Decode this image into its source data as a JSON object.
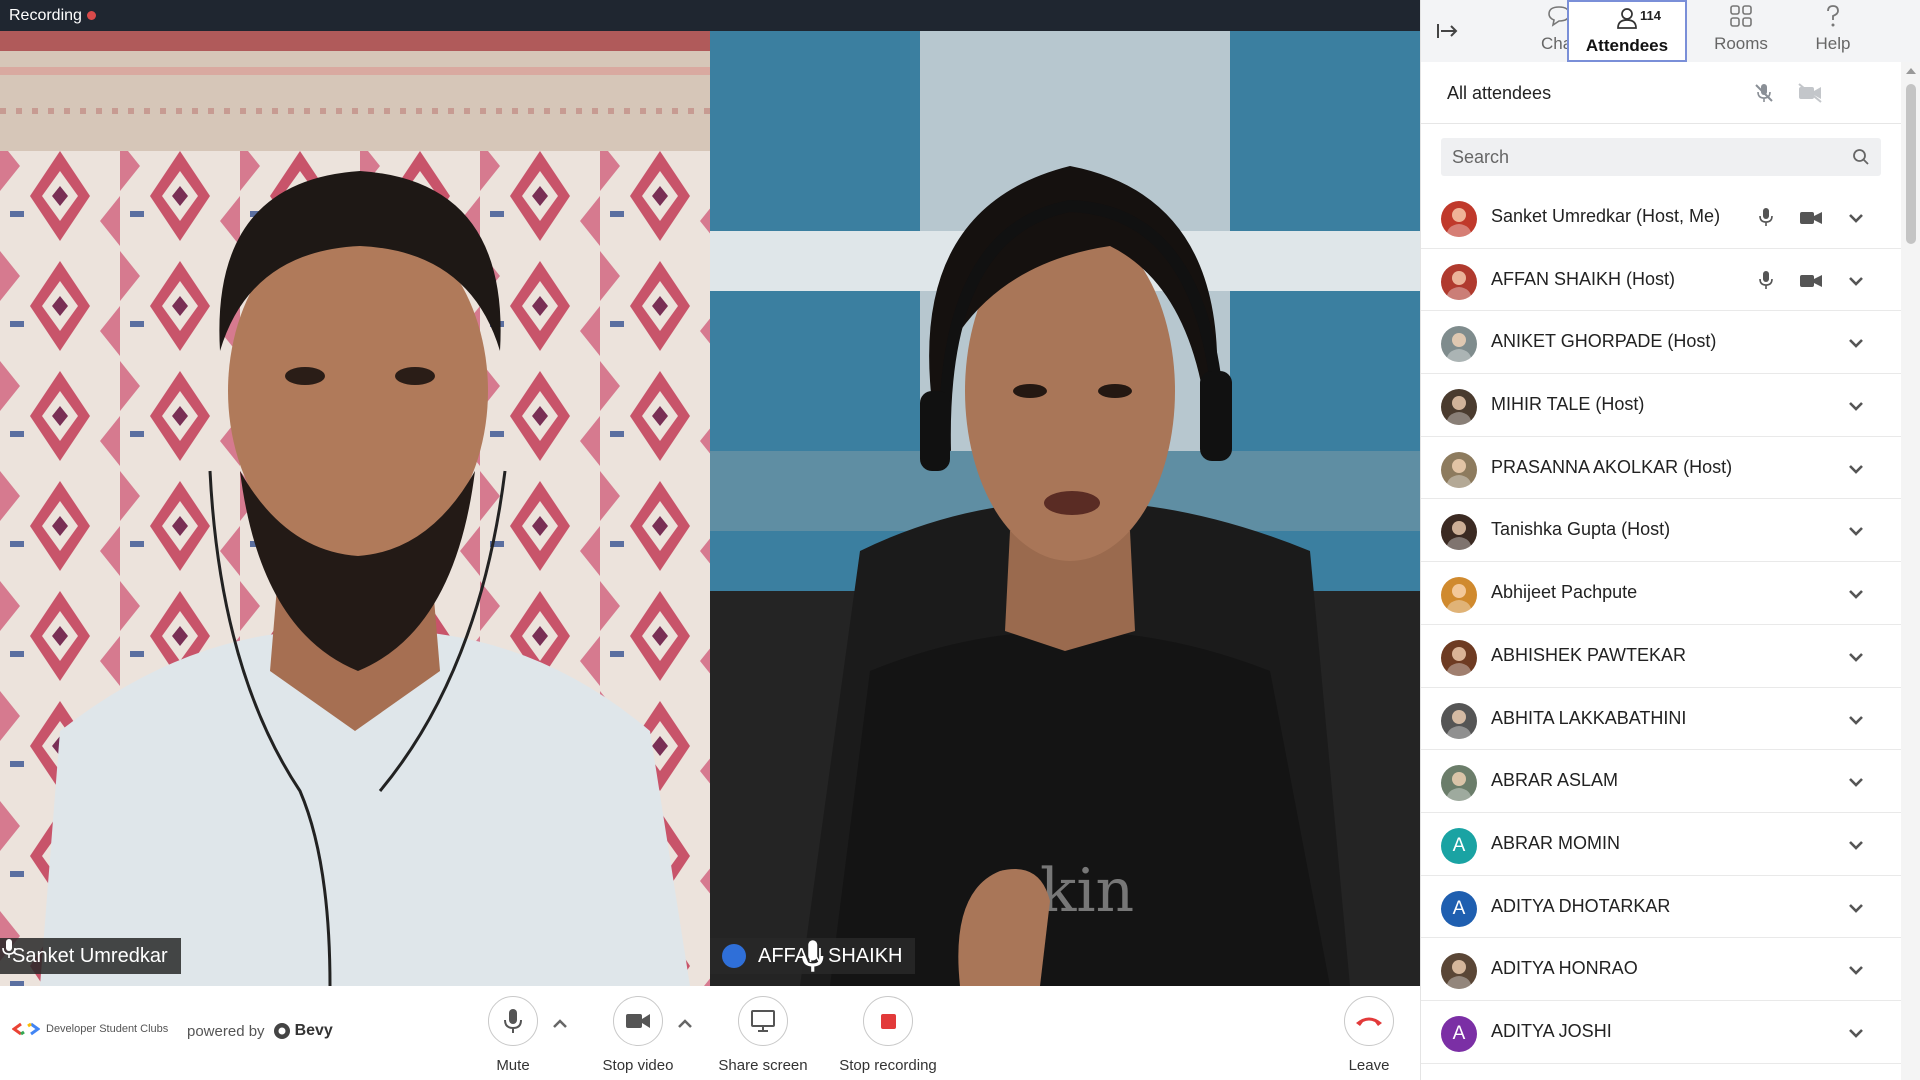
{
  "topbar": {
    "recording_label": "Recording"
  },
  "tiles": [
    {
      "name": "Sanket Umredkar",
      "mic_state": "active"
    },
    {
      "name": "AFFAN SHAIKH",
      "mic_state": "speaking"
    }
  ],
  "bottombar": {
    "brand": "Developer Student Clubs",
    "powered_by": "powered by",
    "bevy": "Bevy",
    "controls": {
      "mute": "Mute",
      "stop_video": "Stop video",
      "share_screen": "Share screen",
      "stop_recording": "Stop recording",
      "leave": "Leave"
    }
  },
  "panel": {
    "tabs": {
      "chat": "Chat",
      "attendees": "Attendees",
      "attendees_count": "114",
      "rooms": "Rooms",
      "help": "Help"
    },
    "all_attendees": "All attendees",
    "search_placeholder": "Search",
    "attendees": [
      {
        "name": "Sanket Umredkar (Host, Me)",
        "avatar": "photo",
        "color": "#c0392b",
        "media": true
      },
      {
        "name": "AFFAN SHAIKH (Host)",
        "avatar": "photo",
        "color": "#b03a2e",
        "media": true
      },
      {
        "name": "ANIKET GHORPADE (Host)",
        "avatar": "photo",
        "color": "#7f8c8d",
        "media": false
      },
      {
        "name": "MIHIR TALE (Host)",
        "avatar": "photo",
        "color": "#4a3b2e",
        "media": false
      },
      {
        "name": "PRASANNA AKOLKAR (Host)",
        "avatar": "photo",
        "color": "#8d7b5e",
        "media": false
      },
      {
        "name": "Tanishka Gupta (Host)",
        "avatar": "photo",
        "color": "#3b2a22",
        "media": false
      },
      {
        "name": "Abhijeet Pachpute",
        "avatar": "photo",
        "color": "#d08a2e",
        "media": false
      },
      {
        "name": "ABHISHEK PAWTEKAR",
        "avatar": "photo",
        "color": "#6e3b22",
        "media": false
      },
      {
        "name": "ABHITA LAKKABATHINI",
        "avatar": "photo",
        "color": "#555555",
        "media": false
      },
      {
        "name": "ABRAR ASLAM",
        "avatar": "photo",
        "color": "#6b7d6a",
        "media": false
      },
      {
        "name": "ABRAR MOMIN",
        "avatar": "A",
        "color": "#1aa3a3",
        "media": false
      },
      {
        "name": "ADITYA DHOTARKAR",
        "avatar": "A",
        "color": "#1f5fb0",
        "media": false
      },
      {
        "name": "ADITYA HONRAO",
        "avatar": "photo",
        "color": "#5a4636",
        "media": false
      },
      {
        "name": "ADITYA JOSHI",
        "avatar": "A",
        "color": "#7b2fa5",
        "media": false
      }
    ]
  }
}
